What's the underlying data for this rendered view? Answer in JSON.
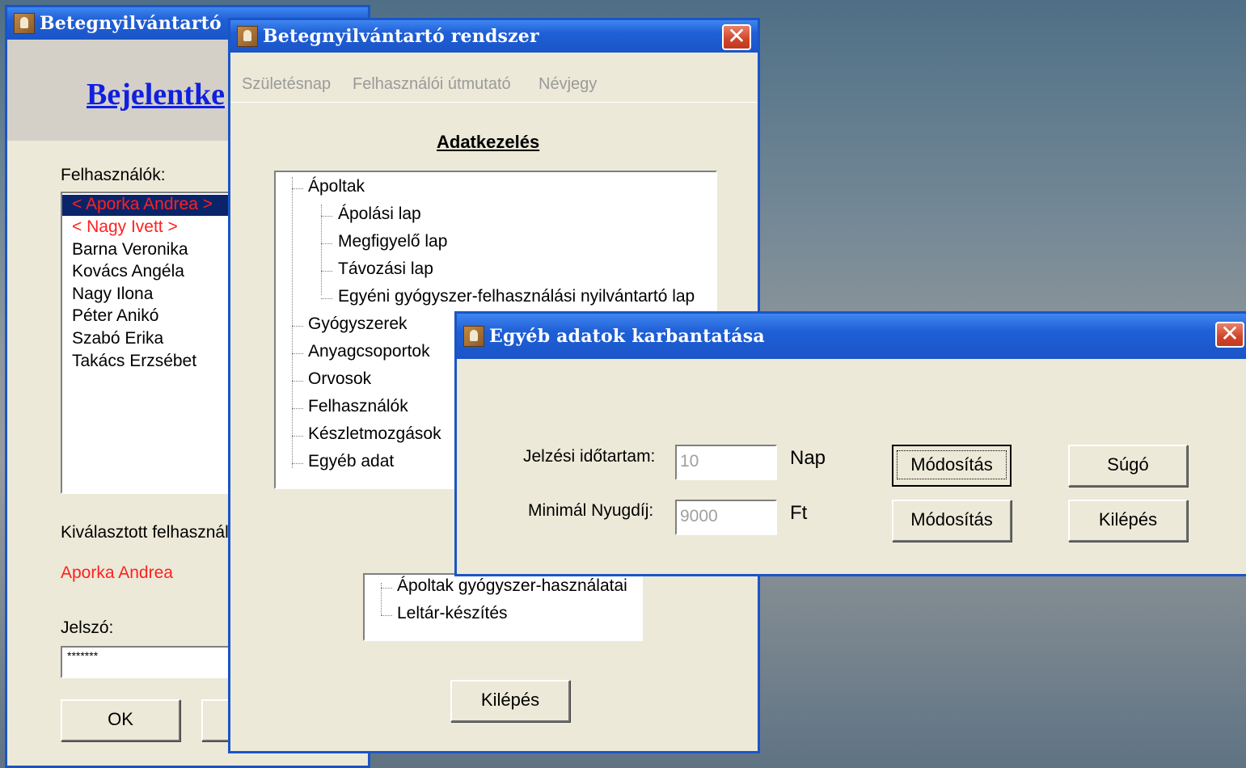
{
  "login_window": {
    "title": "Betegnyilvántartó r",
    "heading": "Bejelentke",
    "users_label": "Felhasználók:",
    "users": [
      "< Aporka Andrea >",
      "< Nagy Ivett >",
      "Barna Veronika",
      "Kovács Angéla",
      "Nagy Ilona",
      "Péter Anikó",
      "Szabó Erika",
      "Takács Erzsébet"
    ],
    "selected_label": "Kiválasztott felhasznál",
    "selected_user": "Aporka Andrea",
    "password_label": "Jelszó:",
    "password_value": "*******",
    "ok_button": "OK"
  },
  "main_window": {
    "title": "Betegnyilvántartó rendszer",
    "menu": [
      "Születésnap",
      "Felhasználói útmutató",
      "Névjegy"
    ],
    "section_title": "Adatkezelés",
    "tree": {
      "apoltak": "Ápoltak",
      "apoltak_children": [
        "Ápolási lap",
        "Megfigyelő lap",
        "Távozási lap",
        "Egyéni gyógyszer-felhasználási nyilvántartó lap"
      ],
      "others": [
        "Gyógyszerek",
        "Anyagcsoportok",
        "Orvosok",
        "Felhasználók",
        "Készletmozgások",
        "Egyéb adat"
      ]
    },
    "reports": [
      "Ápoltak gyógyszer-használatai",
      "Leltár-készítés"
    ],
    "exit_button": "Kilépés"
  },
  "other_data_window": {
    "title": "Egyéb adatok karbantatása",
    "row1": {
      "label": "Jelzési időtartam:",
      "value": "10",
      "unit": "Nap",
      "button": "Módosítás"
    },
    "row2": {
      "label": "Minimál Nyugdíj:",
      "value": "9000",
      "unit": "Ft",
      "button": "Módosítás"
    },
    "help_button": "Súgó",
    "exit_button": "Kilépés"
  },
  "colors": {
    "selected_user": "#ff2020",
    "titlebar": "#1f5fd6",
    "window_bg": "#ece9d8"
  }
}
